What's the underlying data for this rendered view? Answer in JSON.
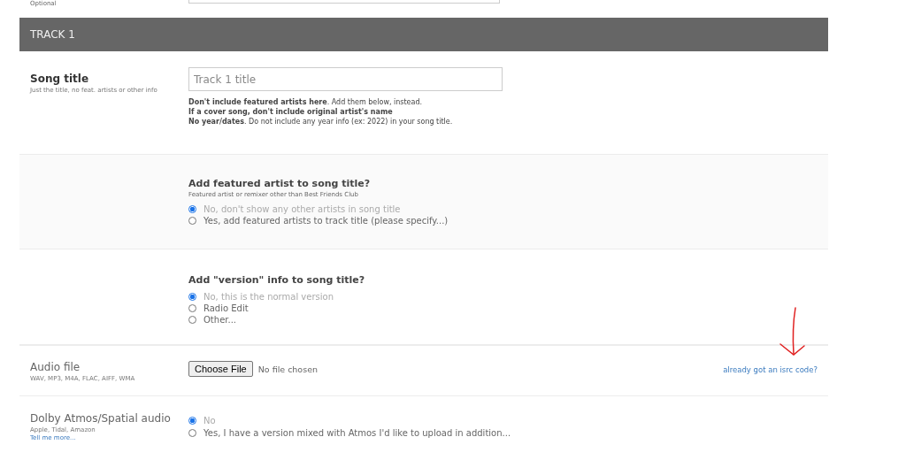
{
  "previous_row": {
    "label": "Optional"
  },
  "track_header": {
    "title": "TRACK 1"
  },
  "song_title": {
    "label": "Song title",
    "sublabel": "Just the title, no feat. artists or other info",
    "placeholder": "Track 1 title",
    "hints": [
      {
        "text": "**Don't include featured artists here**. Add them below, instead.",
        "bold": false
      },
      {
        "text": "If a cover song, don't include original artist's name",
        "bold": true
      },
      {
        "text": "**No year/dates**. Do not include any year info (ex: 2022) in your song title.",
        "bold": false
      }
    ]
  },
  "featured_artist": {
    "question": "Add featured artist to song title?",
    "note": "Featured artist or remixer other than Best Friends Club",
    "options": [
      {
        "label": "No, don't show any other artists in song title",
        "selected": true
      },
      {
        "label": "Yes, add featured artists to track title (please specify...)",
        "selected": false
      }
    ]
  },
  "version_info": {
    "question": "Add \"version\" info to song title?",
    "options": [
      {
        "label": "No, this is the normal version",
        "selected": true
      },
      {
        "label": "Radio Edit",
        "selected": false
      },
      {
        "label": "Other...",
        "selected": false
      }
    ]
  },
  "audio_file": {
    "label": "Audio file",
    "sublabel": "WAV, MP3, M4A, FLAC, AIFF, WMA",
    "button": "Choose File",
    "status": "No file chosen",
    "link": "already got an isrc code?"
  },
  "dolby_atmos": {
    "label": "Dolby Atmos/Spatial audio",
    "sublabel": "Apple, Tidal, Amazon",
    "link": "Tell me more...",
    "options": [
      {
        "label": "No",
        "selected": true
      },
      {
        "label": "Yes, I have a version mixed with Atmos I'd like to upload in addition...",
        "selected": false
      }
    ]
  }
}
